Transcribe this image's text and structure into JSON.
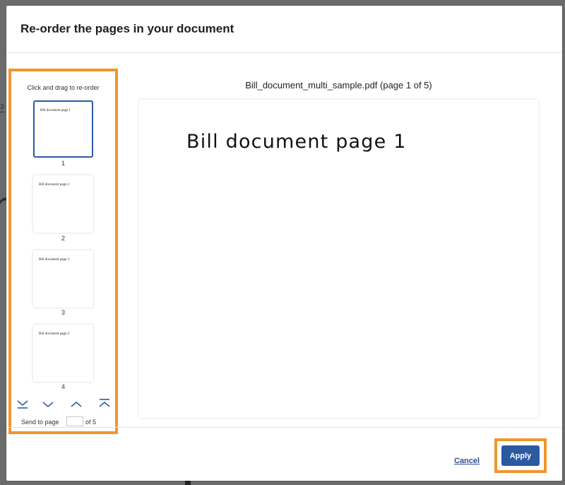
{
  "background": {
    "partial_letter": "n",
    "partial_tab": "3"
  },
  "dialog": {
    "title": "Re-order the pages in your document"
  },
  "thumbnails": {
    "instructions": "Click and drag to re-order",
    "items": [
      {
        "text": "Bill document page 1",
        "number": "1",
        "selected": true
      },
      {
        "text": "Bill document page 2",
        "number": "2",
        "selected": false
      },
      {
        "text": "Bill document page 3",
        "number": "3",
        "selected": false
      },
      {
        "text": "Bill document page 4",
        "number": "4",
        "selected": false
      }
    ],
    "send_to_page_label": "Send to page",
    "send_to_page_value": "",
    "send_to_page_of": "of 5",
    "arrow_icons": [
      "move-to-bottom-icon",
      "move-down-icon",
      "move-up-icon",
      "move-to-top-icon"
    ]
  },
  "preview": {
    "filename": "Bill_document_multi_sample.pdf (page 1 of 5)",
    "page_text": "Bill document page 1"
  },
  "footer": {
    "cancel_label": "Cancel",
    "apply_label": "Apply"
  },
  "colors": {
    "accent_highlight": "#f0962d",
    "primary_button": "#2b5aa3",
    "link": "#2b4f8c"
  }
}
